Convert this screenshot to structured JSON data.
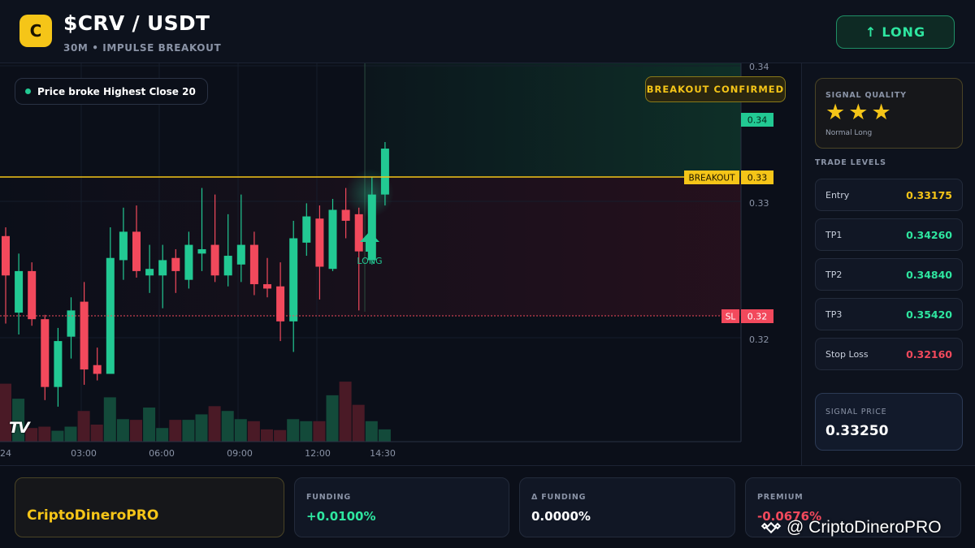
{
  "header": {
    "logo_letter": "C",
    "pair": "$CRV / USDT",
    "subtitle": "30M • IMPULSE BREAKOUT",
    "long_button": {
      "icon": "up-arrow-icon",
      "label": "LONG"
    }
  },
  "chart": {
    "breakout_note": "Price broke Highest Close 20",
    "confirmed_badge": "BREAKOUT CONFIRMED",
    "watermark_logo": "TV",
    "colors": {
      "up": "#22c993",
      "down": "#f2495c",
      "breakout": "#f5c518",
      "stop": "#f2495c"
    }
  },
  "chart_data": {
    "type": "candlestick",
    "x_ticks": [
      "24",
      "03:00",
      "06:00",
      "09:00",
      "12:00",
      "14:30"
    ],
    "y_ticks": [
      "0.34",
      "0.34",
      "0.33",
      "0.32"
    ],
    "breakout_level": {
      "label": "BREAKOUT",
      "value": "0.33"
    },
    "current_price_label": "0.34",
    "stop_loss_level": {
      "label": "SL",
      "value": "0.32"
    },
    "signal_marker": "LONG",
    "candles": [
      {
        "o": 0.3266,
        "h": 0.327,
        "l": 0.3226,
        "c": 0.3248
      },
      {
        "o": 0.3231,
        "h": 0.3258,
        "l": 0.3221,
        "c": 0.325
      },
      {
        "o": 0.325,
        "h": 0.3254,
        "l": 0.3225,
        "c": 0.3228
      },
      {
        "o": 0.3228,
        "h": 0.323,
        "l": 0.3191,
        "c": 0.3197
      },
      {
        "o": 0.3197,
        "h": 0.3224,
        "l": 0.3188,
        "c": 0.3218
      },
      {
        "o": 0.322,
        "h": 0.3238,
        "l": 0.321,
        "c": 0.3232
      },
      {
        "o": 0.3236,
        "h": 0.3245,
        "l": 0.3198,
        "c": 0.3205
      },
      {
        "o": 0.3207,
        "h": 0.3215,
        "l": 0.32,
        "c": 0.3203
      },
      {
        "o": 0.3203,
        "h": 0.327,
        "l": 0.3203,
        "c": 0.3256
      },
      {
        "o": 0.3255,
        "h": 0.3279,
        "l": 0.3246,
        "c": 0.3268
      },
      {
        "o": 0.3268,
        "h": 0.328,
        "l": 0.3247,
        "c": 0.325
      },
      {
        "o": 0.3248,
        "h": 0.3262,
        "l": 0.324,
        "c": 0.3251
      },
      {
        "o": 0.3248,
        "h": 0.3262,
        "l": 0.3233,
        "c": 0.3255
      },
      {
        "o": 0.3256,
        "h": 0.326,
        "l": 0.324,
        "c": 0.325
      },
      {
        "o": 0.3246,
        "h": 0.3268,
        "l": 0.3242,
        "c": 0.3262
      },
      {
        "o": 0.3258,
        "h": 0.3288,
        "l": 0.325,
        "c": 0.326
      },
      {
        "o": 0.3262,
        "h": 0.3285,
        "l": 0.3245,
        "c": 0.3248
      },
      {
        "o": 0.3248,
        "h": 0.3276,
        "l": 0.3243,
        "c": 0.3257
      },
      {
        "o": 0.3253,
        "h": 0.3285,
        "l": 0.3245,
        "c": 0.3262
      },
      {
        "o": 0.3262,
        "h": 0.3268,
        "l": 0.3239,
        "c": 0.3244
      },
      {
        "o": 0.3244,
        "h": 0.3256,
        "l": 0.3238,
        "c": 0.3242
      },
      {
        "o": 0.3243,
        "h": 0.3254,
        "l": 0.3218,
        "c": 0.3227
      },
      {
        "o": 0.3227,
        "h": 0.3273,
        "l": 0.3213,
        "c": 0.3265
      },
      {
        "o": 0.3263,
        "h": 0.3281,
        "l": 0.3257,
        "c": 0.3275
      },
      {
        "o": 0.3274,
        "h": 0.328,
        "l": 0.3237,
        "c": 0.3252
      },
      {
        "o": 0.3251,
        "h": 0.3283,
        "l": 0.325,
        "c": 0.3278
      },
      {
        "o": 0.3278,
        "h": 0.3288,
        "l": 0.3265,
        "c": 0.3273
      },
      {
        "o": 0.3276,
        "h": 0.3279,
        "l": 0.3232,
        "c": 0.3259
      },
      {
        "o": 0.3255,
        "h": 0.3293,
        "l": 0.3253,
        "c": 0.3285
      },
      {
        "o": 0.3285,
        "h": 0.3309,
        "l": 0.328,
        "c": 0.3306
      }
    ],
    "volumes": [
      0.85,
      0.63,
      0.2,
      0.22,
      0.16,
      0.22,
      0.45,
      0.25,
      0.65,
      0.33,
      0.32,
      0.5,
      0.2,
      0.32,
      0.32,
      0.4,
      0.52,
      0.45,
      0.33,
      0.3,
      0.18,
      0.17,
      0.33,
      0.3,
      0.3,
      0.68,
      0.88,
      0.54,
      0.3,
      0.18
    ],
    "y_range": [
      0.3172,
      0.3345
    ]
  },
  "sidebar": {
    "quality": {
      "label": "SIGNAL QUALITY",
      "stars": 3,
      "star_icon": "star-icon",
      "note": "Normal Long"
    },
    "levels_label": "TRADE LEVELS",
    "levels": [
      {
        "name": "Entry",
        "value": "0.33175",
        "color": "#f5c518"
      },
      {
        "name": "TP1",
        "value": "0.34260",
        "color": "#2ee6a0"
      },
      {
        "name": "TP2",
        "value": "0.34840",
        "color": "#2ee6a0"
      },
      {
        "name": "TP3",
        "value": "0.35420",
        "color": "#2ee6a0"
      },
      {
        "name": "Stop Loss",
        "value": "0.32160",
        "color": "#f2495c"
      }
    ],
    "signal_price": {
      "label": "SIGNAL PRICE",
      "value": "0.33250"
    }
  },
  "footer": {
    "brand": "CriptoDineroPRO",
    "funding": {
      "label": "FUNDING",
      "value": "+0.0100%",
      "color": "#2ee6a0"
    },
    "delta_funding": {
      "label": "Δ FUNDING",
      "value": "0.0000%",
      "color": "#ffffff"
    },
    "premium": {
      "label": "PREMIUM",
      "value": "-0.0676%",
      "color": "#f2495c"
    },
    "watermark": "@ CriptoDineroPRO",
    "watermark_icon": "binance-icon"
  }
}
